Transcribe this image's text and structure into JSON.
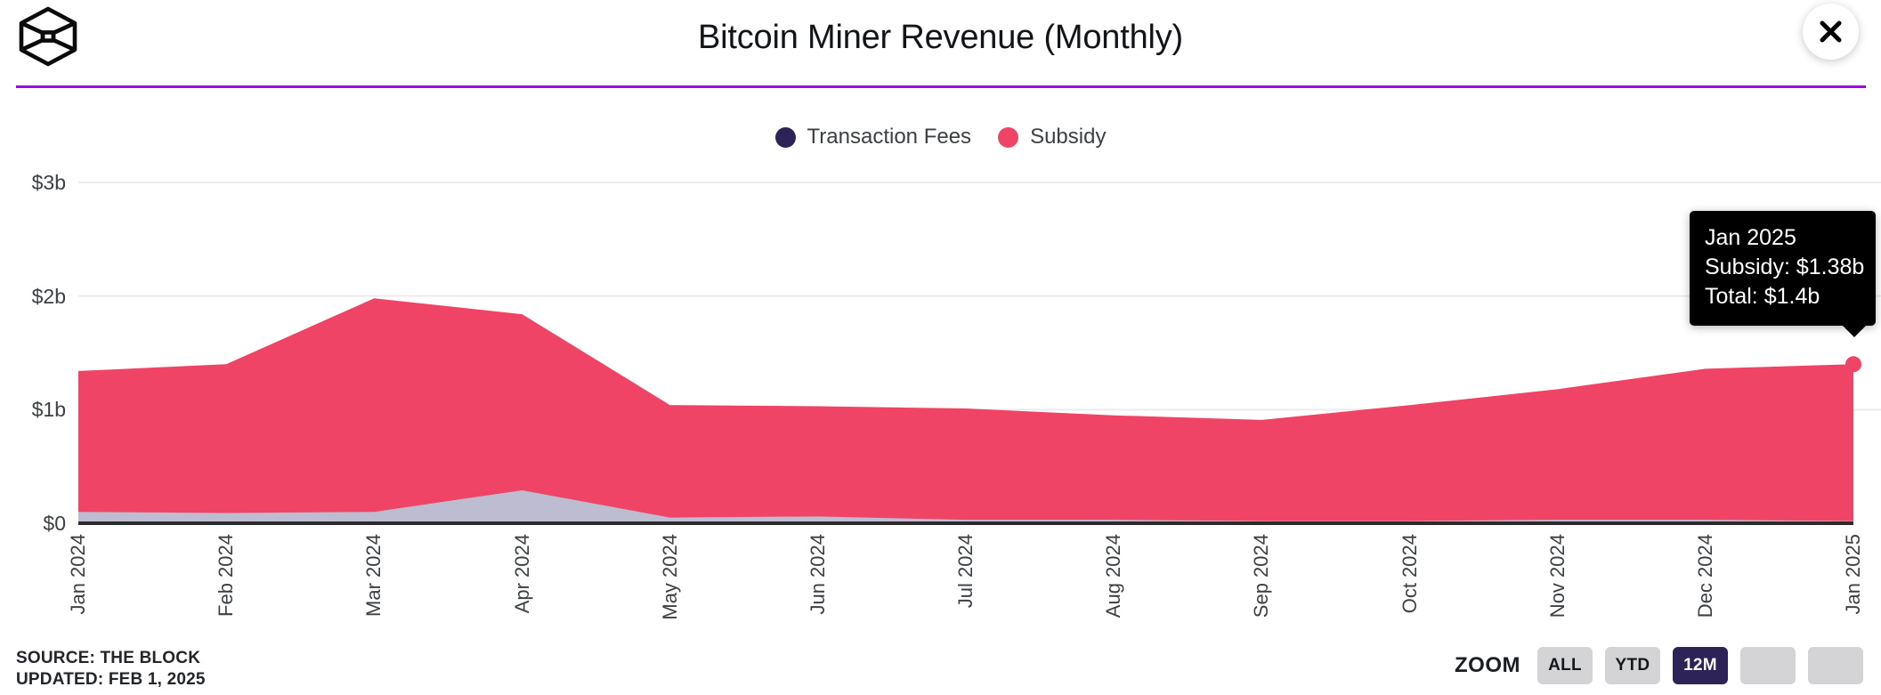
{
  "header": {
    "logo_name": "the-block-cube-logo",
    "title": "Bitcoin Miner Revenue (Monthly)",
    "close_label": "✕",
    "rule_color": "#9B00E8"
  },
  "legend": {
    "items": [
      {
        "label": "Transaction Fees",
        "color": "#2D2356"
      },
      {
        "label": "Subsidy",
        "color": "#EF4465"
      }
    ]
  },
  "tooltip": {
    "title": "Jan 2025",
    "subsidy": "Subsidy: $1.38b",
    "total": "Total: $1.4b"
  },
  "footer": {
    "source": "SOURCE: THE BLOCK",
    "updated": "UPDATED: FEB 1, 2025"
  },
  "zoom": {
    "label": "ZOOM",
    "buttons": [
      {
        "label": "ALL",
        "active": false
      },
      {
        "label": "YTD",
        "active": false
      },
      {
        "label": "12M",
        "active": true
      },
      {
        "label": "",
        "active": false
      },
      {
        "label": "",
        "active": false
      }
    ]
  },
  "chart_data": {
    "type": "area",
    "stacked": true,
    "title": "Bitcoin Miner Revenue (Monthly)",
    "xlabel": "",
    "ylabel": "",
    "ylim": [
      0,
      3.2
    ],
    "yticks": [
      0,
      1,
      2,
      3
    ],
    "ytick_labels": [
      "$0",
      "$1b",
      "$2b",
      "$3b"
    ],
    "grid": true,
    "legend_position": "top-center",
    "units": "billions of USD",
    "categories": [
      "Jan 2024",
      "Feb 2024",
      "Mar 2024",
      "Apr 2024",
      "May 2024",
      "Jun 2024",
      "Jul 2024",
      "Aug 2024",
      "Sep 2024",
      "Oct 2024",
      "Nov 2024",
      "Dec 2024",
      "Jan 2025"
    ],
    "series": [
      {
        "name": "Transaction Fees",
        "color": "#BEBCD0",
        "values": [
          0.1,
          0.09,
          0.1,
          0.29,
          0.05,
          0.06,
          0.03,
          0.03,
          0.02,
          0.02,
          0.03,
          0.03,
          0.02
        ]
      },
      {
        "name": "Subsidy",
        "color": "#EF4465",
        "values": [
          1.24,
          1.31,
          1.88,
          1.55,
          0.99,
          0.97,
          0.98,
          0.92,
          0.89,
          1.02,
          1.15,
          1.33,
          1.38
        ]
      }
    ],
    "totals": [
      1.34,
      1.4,
      1.98,
      1.84,
      1.04,
      1.03,
      1.01,
      0.95,
      0.91,
      1.04,
      1.18,
      1.36,
      1.4
    ],
    "highlight": {
      "category": "Jan 2025",
      "series": "Subsidy",
      "value": 1.38,
      "total": 1.4
    }
  }
}
